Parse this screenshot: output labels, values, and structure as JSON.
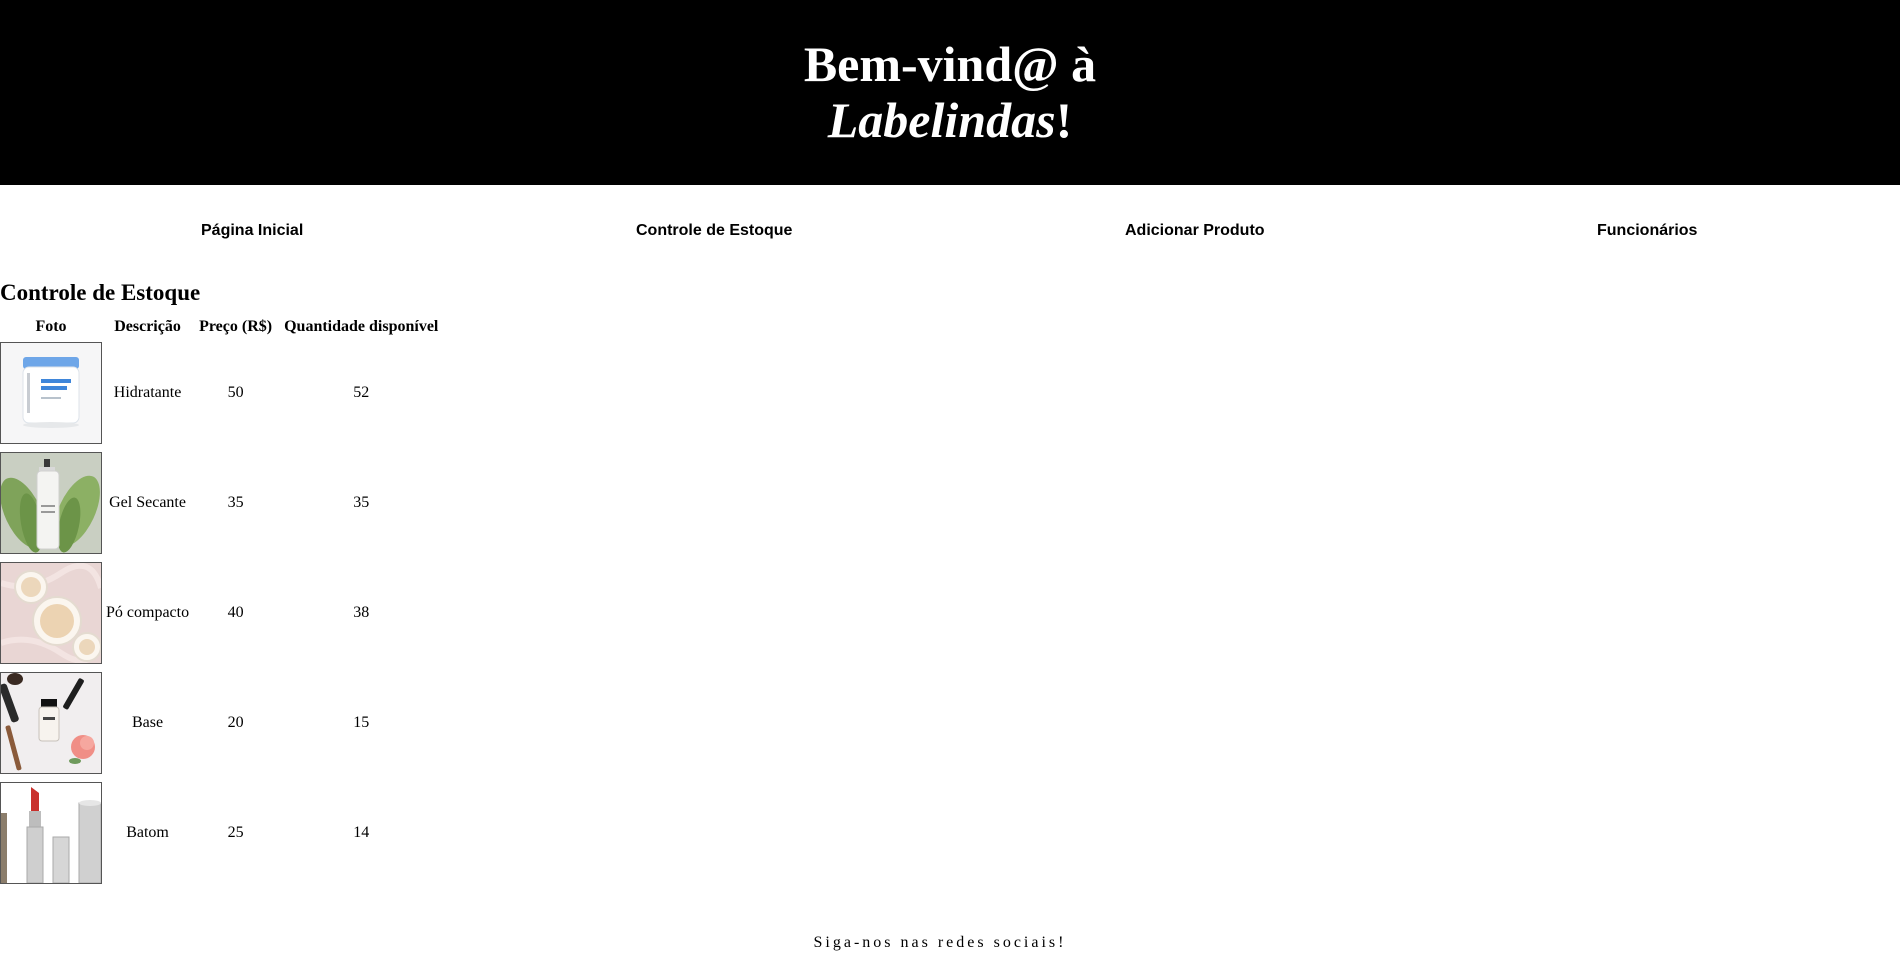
{
  "header": {
    "title_prefix": "Bem-vind@ à",
    "title_brand": "Labelindas",
    "title_suffix": "!"
  },
  "nav": {
    "items": [
      {
        "label": "Página Inicial"
      },
      {
        "label": "Controle de Estoque"
      },
      {
        "label": "Adicionar Produto"
      },
      {
        "label": "Funcionários"
      }
    ]
  },
  "inventory": {
    "title": "Controle de Estoque",
    "columns": [
      "Foto",
      "Descrição",
      "Preço (R$)",
      "Quantidade disponível"
    ],
    "rows": [
      {
        "description": "Hidratante",
        "price": "50",
        "quantity": "52"
      },
      {
        "description": "Gel Secante",
        "price": "35",
        "quantity": "35"
      },
      {
        "description": "Pó compacto",
        "price": "40",
        "quantity": "38"
      },
      {
        "description": "Base",
        "price": "20",
        "quantity": "15"
      },
      {
        "description": "Batom",
        "price": "25",
        "quantity": "14"
      }
    ]
  },
  "footer": {
    "text": "Siga-nos nas redes sociais!"
  }
}
